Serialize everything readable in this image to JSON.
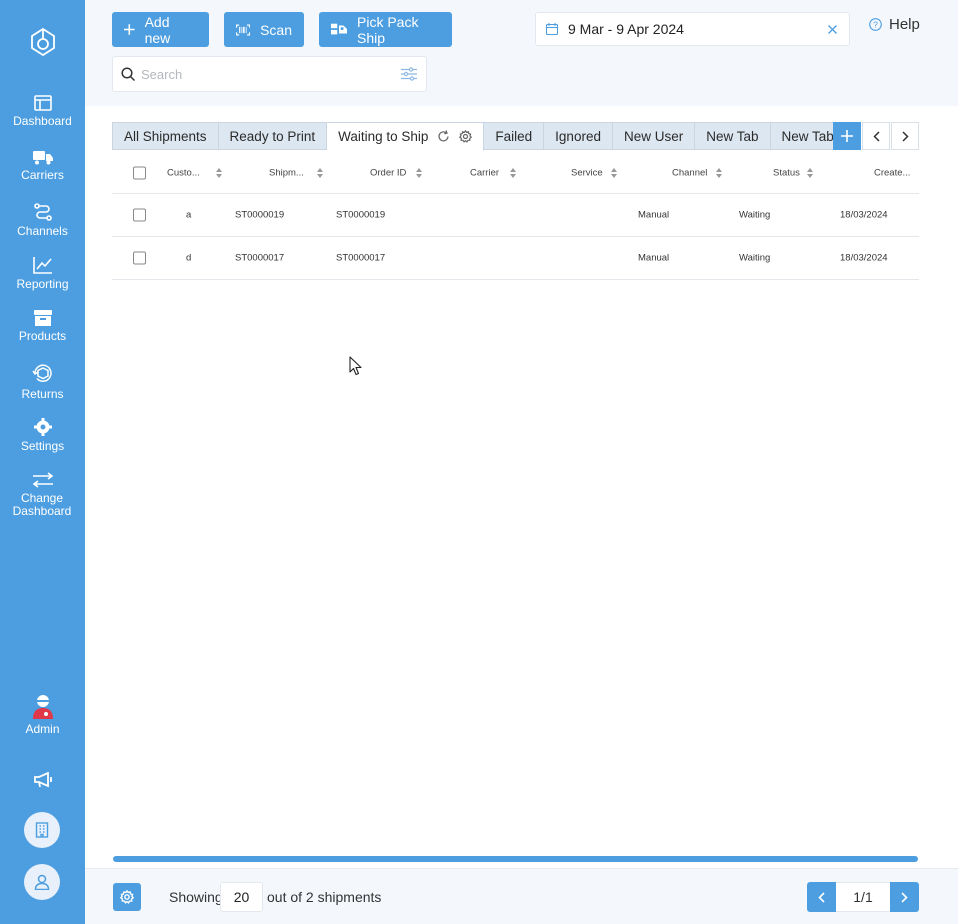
{
  "sidebar": {
    "items": [
      {
        "label": "Dashboard",
        "icon": "dashboard-icon"
      },
      {
        "label": "Carriers",
        "icon": "truck-icon"
      },
      {
        "label": "Channels",
        "icon": "route-icon"
      },
      {
        "label": "Reporting",
        "icon": "chart-line-icon"
      },
      {
        "label": "Products",
        "icon": "box-icon"
      },
      {
        "label": "Returns",
        "icon": "return-box-icon"
      },
      {
        "label": "Settings",
        "icon": "gear-icon"
      },
      {
        "label": "Change Dashboard",
        "icon": "swap-arrows-icon"
      }
    ],
    "admin_label": "Admin"
  },
  "toolbar": {
    "add_new_label": "Add new",
    "scan_label": "Scan",
    "pick_pack_ship_label": "Pick Pack Ship"
  },
  "date_range": "9 Mar - 9 Apr 2024",
  "help_label": "Help",
  "search": {
    "placeholder": "Search",
    "value": ""
  },
  "tabs": [
    {
      "label": "All Shipments",
      "active": false
    },
    {
      "label": "Ready to Print",
      "active": false
    },
    {
      "label": "Waiting to Ship",
      "active": true
    },
    {
      "label": "Failed",
      "active": false
    },
    {
      "label": "Ignored",
      "active": false
    },
    {
      "label": "New User",
      "active": false
    },
    {
      "label": "New Tab",
      "active": false
    },
    {
      "label": "New Tab",
      "active": false
    }
  ],
  "table": {
    "columns": [
      "Custo...",
      "Shipm...",
      "Order ID",
      "Carrier",
      "Service",
      "Channel",
      "Status",
      "Create..."
    ],
    "rows": [
      {
        "customer": "a",
        "shipment": "ST0000019",
        "order_id": "ST0000019",
        "carrier": "",
        "service": "",
        "channel": "Manual",
        "status": "Waiting",
        "created": "18/03/2024"
      },
      {
        "customer": "d",
        "shipment": "ST0000017",
        "order_id": "ST0000017",
        "carrier": "",
        "service": "",
        "channel": "Manual",
        "status": "Waiting",
        "created": "18/03/2024"
      }
    ]
  },
  "footer": {
    "showing_label": "Showing",
    "page_size": "20",
    "out_of_label": "out of 2 shipments",
    "page_indicator": "1/1"
  },
  "colors": {
    "accent": "#4d9ee0",
    "tab_bg": "#dde7f1",
    "admin_red": "#e0384a"
  }
}
